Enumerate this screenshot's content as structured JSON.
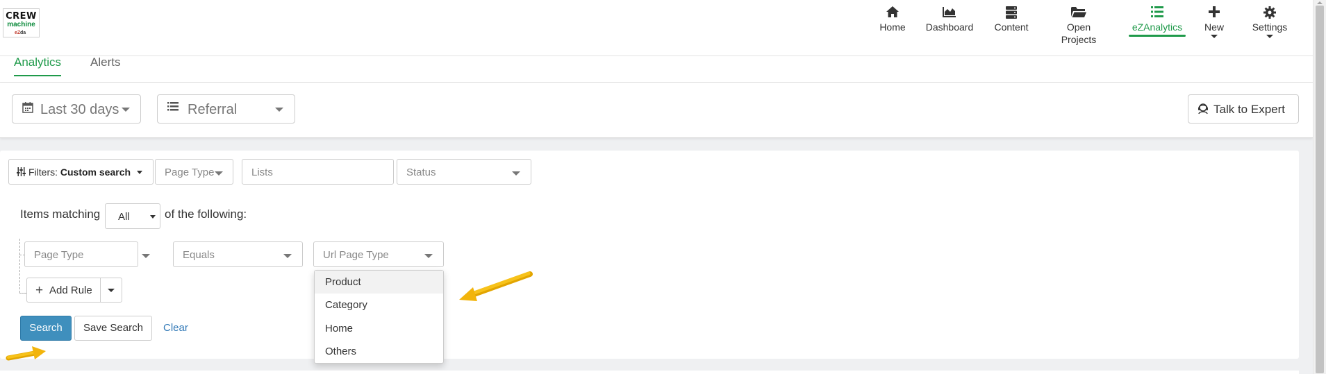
{
  "app": {
    "logo_line1": "CREW",
    "logo_line2": "machine",
    "logo_line3": "ezdeals"
  },
  "nav": {
    "items": [
      {
        "label": "Home",
        "icon": "home-icon"
      },
      {
        "label": "Dashboard",
        "icon": "area-chart-icon"
      },
      {
        "label": "Content",
        "icon": "server-icon"
      },
      {
        "label": "Open Projects",
        "icon": "folder-open-icon"
      },
      {
        "label": "eZAnalytics",
        "icon": "list-icon",
        "active": true
      },
      {
        "label": "New",
        "icon": "plus-icon"
      },
      {
        "label": "Settings",
        "icon": "gear-icon"
      }
    ],
    "open_label_l1": "Open",
    "open_label_l2": "Projects",
    "active_color": "#1f9a4a"
  },
  "tabs": {
    "analytics": "Analytics",
    "alerts": "Alerts"
  },
  "controls": {
    "date_range": "Last 30 days",
    "source": "Referral",
    "talk_to_expert": "Talk to Expert"
  },
  "filters": {
    "filters_prefix": "Filters:",
    "filters_value": "Custom search",
    "page_type": "Page Type",
    "lists_placeholder": "Lists",
    "status": "Status"
  },
  "query": {
    "items_matching": "Items matching",
    "match_mode": "All",
    "of_following": "of the following:",
    "rule": {
      "field": "Page Type",
      "operator": "Equals",
      "value_placeholder": "Url Page Type"
    },
    "add_rule": "Add Rule"
  },
  "dropdown": {
    "options": [
      "Product",
      "Category",
      "Home",
      "Others"
    ],
    "highlighted": "Product"
  },
  "actions": {
    "search": "Search",
    "save_search": "Save Search",
    "clear": "Clear"
  },
  "colors": {
    "accent_green": "#1f9a4a",
    "primary_blue": "#3f8fbd",
    "arrow_yellow": "#f5b70a"
  }
}
